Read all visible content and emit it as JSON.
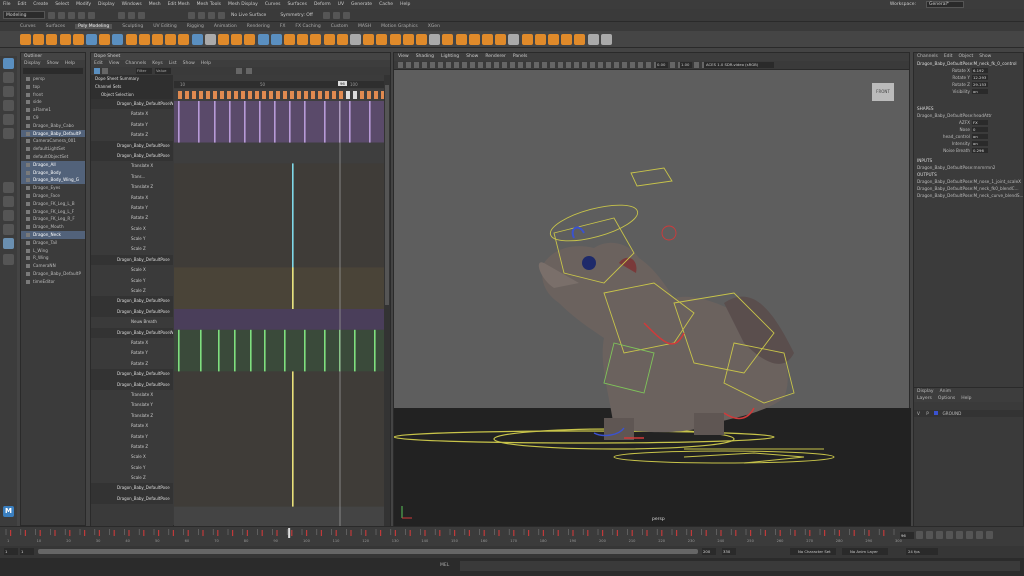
{
  "menubar": [
    "File",
    "Edit",
    "Create",
    "Select",
    "Modify",
    "Display",
    "Windows",
    "Mesh",
    "Edit Mesh",
    "Mesh Tools",
    "Mesh Display",
    "Curves",
    "Surfaces",
    "Deform",
    "UV",
    "Generate",
    "Cache",
    "Help"
  ],
  "workspace": {
    "label": "Workspace:",
    "value": "General*"
  },
  "status": {
    "mode": "Modeling",
    "live_surface": "No Live Surface",
    "symmetry": "Symmetry: Off"
  },
  "shelf_tabs": [
    "Curves",
    "Surfaces",
    "Poly Modeling",
    "Sculpting",
    "UV Editing",
    "Rigging",
    "Animation",
    "Rendering",
    "FX",
    "FX Caching",
    "Custom",
    "MASH",
    "Motion Graphics",
    "XGen"
  ],
  "shelf_active_tab": "Poly Modeling",
  "outliner": {
    "title": "Outliner",
    "menu": [
      "Display",
      "Show",
      "Help"
    ],
    "items": [
      "persp",
      "top",
      "front",
      "side",
      "aFlame1",
      "C9",
      "Dragon_Baby_Cabo",
      "Dragon_Baby_DefaultP",
      "CameraCamera_001",
      "defaultLightSet",
      "defaultObjectSet",
      "Dragon_All",
      "Dragon_Body",
      "Dragon_Body_Wing_G",
      "Dragon_Eyes",
      "Dragon_Face",
      "Dragon_FK_Leg_L_B",
      "Dragon_FK_Leg_L_F",
      "Dragon_FK_Leg_R_F",
      "Dragon_Mouth",
      "Dragon_Neck",
      "Dragon_Tail",
      "L_Wing",
      "R_Wing",
      "CameraNN",
      "Dragon_Baby_DefaultP",
      "timeEditor"
    ],
    "selected": [
      7,
      11,
      12,
      13,
      20
    ]
  },
  "dopesheet": {
    "title": "Dope Sheet",
    "menu": [
      "Edit",
      "View",
      "Channels",
      "Keys",
      "List",
      "Show",
      "Help"
    ],
    "filter": "Filter",
    "value": "Value",
    "summary": "Dope Sheet Summary",
    "channel_sets": "Channel Sets",
    "object_selection": "Object Selection",
    "rows": [
      {
        "t": "obj",
        "l": "Dragon_Baby_DefaultPoseWi"
      },
      {
        "t": "ch",
        "l": "Rotate X"
      },
      {
        "t": "ch",
        "l": "Rotate Y"
      },
      {
        "t": "ch",
        "l": "Rotate Z"
      },
      {
        "t": "obj",
        "l": "Dragon_Baby_DefaultPose"
      },
      {
        "t": "obj",
        "l": "Dragon_Baby_DefaultPose"
      },
      {
        "t": "ch",
        "l": "Translate X"
      },
      {
        "t": "ch",
        "l": "Trans..."
      },
      {
        "t": "ch",
        "l": "Translate Z"
      },
      {
        "t": "ch",
        "l": "Rotate X"
      },
      {
        "t": "ch",
        "l": "Rotate Y"
      },
      {
        "t": "ch",
        "l": "Rotate Z"
      },
      {
        "t": "ch",
        "l": "Scale X"
      },
      {
        "t": "ch",
        "l": "Scale Y"
      },
      {
        "t": "ch",
        "l": "Scale Z"
      },
      {
        "t": "obj",
        "l": "Dragon_Baby_DefaultPose"
      },
      {
        "t": "ch",
        "l": "Scale X"
      },
      {
        "t": "ch",
        "l": "Scale Y"
      },
      {
        "t": "ch",
        "l": "Scale Z"
      },
      {
        "t": "obj",
        "l": "Dragon_Baby_DefaultPose"
      },
      {
        "t": "obj",
        "l": "Dragon_Baby_DefaultPose"
      },
      {
        "t": "ch",
        "l": "Neuw Breath"
      },
      {
        "t": "obj",
        "l": "Dragon_Baby_DefaultPoseWi"
      },
      {
        "t": "ch",
        "l": "Rotate X"
      },
      {
        "t": "ch",
        "l": "Rotate Y"
      },
      {
        "t": "ch",
        "l": "Rotate Z"
      },
      {
        "t": "obj",
        "l": "Dragon_Baby_DefaultPose"
      },
      {
        "t": "obj",
        "l": "Dragon_Baby_DefaultPose"
      },
      {
        "t": "ch",
        "l": "Translate X"
      },
      {
        "t": "ch",
        "l": "Translate Y"
      },
      {
        "t": "ch",
        "l": "Translate Z"
      },
      {
        "t": "ch",
        "l": "Rotate X"
      },
      {
        "t": "ch",
        "l": "Rotate Y"
      },
      {
        "t": "ch",
        "l": "Rotate Z"
      },
      {
        "t": "ch",
        "l": "Scale X"
      },
      {
        "t": "ch",
        "l": "Scale Y"
      },
      {
        "t": "ch",
        "l": "Scale Z"
      },
      {
        "t": "obj",
        "l": "Dragon_Baby_DefaultPose"
      },
      {
        "t": "obj",
        "l": "Dragon_Baby_DefaultPose"
      }
    ],
    "ruler": [
      "10",
      "50",
      "100"
    ],
    "current_frame": "96"
  },
  "viewport": {
    "menu": [
      "View",
      "Shading",
      "Lighting",
      "Show",
      "Renderer",
      "Panels"
    ],
    "camera_label": "persp",
    "colorspace": "ACES 1.0 SDR-video (sRGB)",
    "gamma_value": "1.00",
    "exposure_value": "0.00",
    "viewcube_label": "FRONT"
  },
  "channelbox": {
    "menu": [
      "Channels",
      "Edit",
      "Object",
      "Show"
    ],
    "node": "Dragon_Baby_DefaultPose:M_neck_fk_0_control",
    "attrs": [
      {
        "n": "Rotate X",
        "v": "6.192"
      },
      {
        "n": "Rotate Y",
        "v": "12.293"
      },
      {
        "n": "Rotate Z",
        "v": "29.153"
      },
      {
        "n": "Visibility",
        "v": "on"
      }
    ],
    "shapes_header": "SHAPES",
    "shape_node": "Dragon_Baby_DefaultPose:headAttr",
    "shape_attrs": [
      {
        "n": "AZFX",
        "v": "FX"
      },
      {
        "n": "Nose",
        "v": "0"
      },
      {
        "n": "head_control",
        "v": "on"
      },
      {
        "n": "Intensity",
        "v": "on"
      },
      {
        "n": "Noise Breath",
        "v": "0.296"
      }
    ],
    "inputs_header": "INPUTS",
    "inputs": [
      "Dragon_Baby_DefaultPose:mnmrmn2"
    ],
    "outputs_header": "OUTPUTS",
    "outputs": [
      "Dragon_Baby_DefaultPose:M_nose_1_joint_scaleX",
      "Dragon_Baby_DefaultPose:M_neck_fk0_blendC...",
      "Dragon_Baby_DefaultPose:M_neck_curve_blendS..."
    ],
    "layer_tabs": [
      "Display",
      "Anim"
    ],
    "layer_menu": [
      "Layers",
      "Options",
      "Help"
    ],
    "layer": {
      "v": "V",
      "p": "P",
      "name": "GROUND"
    }
  },
  "timeline": {
    "ticks": [
      "1",
      "5",
      "10",
      "15",
      "20",
      "25",
      "30",
      "35",
      "40",
      "45",
      "50",
      "55",
      "60",
      "65",
      "70",
      "75",
      "80",
      "85",
      "90",
      "95",
      "100",
      "105",
      "110",
      "115",
      "120",
      "125",
      "130",
      "135",
      "140",
      "145",
      "150",
      "155",
      "160",
      "165",
      "170",
      "175",
      "180",
      "185",
      "190",
      "195",
      "200",
      "205",
      "210",
      "215",
      "220",
      "225",
      "230",
      "235",
      "240",
      "245",
      "250",
      "255",
      "260",
      "265",
      "270",
      "275",
      "280",
      "285",
      "290",
      "295",
      "300"
    ],
    "current_frame": "96",
    "start": "1",
    "range_start": "1",
    "range_end": "200",
    "end": "330",
    "fps": "24 fps",
    "character_set": "No Character Set",
    "anim_layer": "No Anim Layer"
  },
  "cmdline": {
    "lang": "MEL"
  },
  "toolbox_logo": "M"
}
